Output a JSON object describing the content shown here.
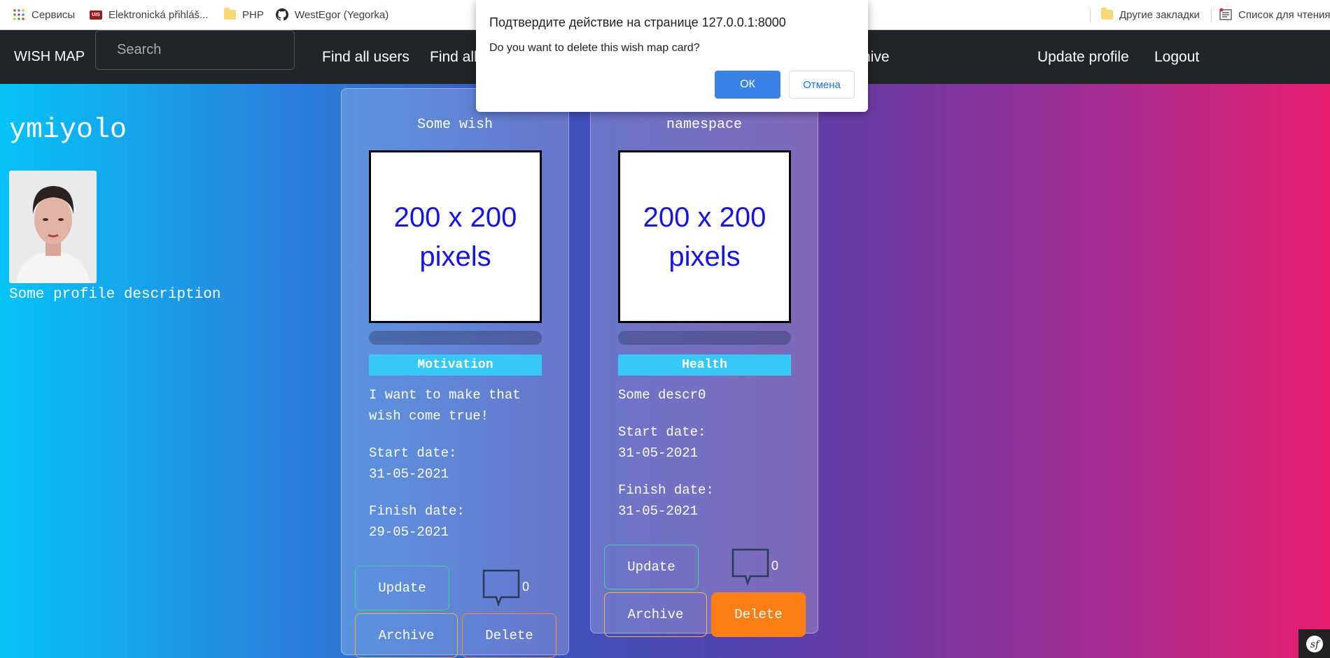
{
  "bookmarks": {
    "items": [
      {
        "label": "Сервисы"
      },
      {
        "label": "Elektronická přihláš..."
      },
      {
        "label": "PHP"
      },
      {
        "label": "WestEgor (Yegorka)"
      }
    ],
    "other_bookmarks": "Другие закладки",
    "reading_list": "Список для чтения"
  },
  "navbar": {
    "brand": "WISH MAP",
    "search_placeholder": "Search",
    "links": [
      "Find all users",
      "Find all",
      "hive"
    ],
    "right_links": [
      "Update profile",
      "Logout"
    ]
  },
  "profile": {
    "username": "ymiyolo",
    "description": "Some profile description"
  },
  "cards": [
    {
      "title": "Some wish",
      "image_text_line1": "200 x 200",
      "image_text_line2": "pixels",
      "category": "Motivation",
      "description_line1": "I want to make that",
      "description_line2": "wish come true!",
      "start_label": "Start date:",
      "start_date": "31-05-2021",
      "finish_label": "Finish date:",
      "finish_date": "29-05-2021",
      "update": "Update",
      "archive": "Archive",
      "delete": "Delete",
      "comments": "0"
    },
    {
      "title": "namespace",
      "image_text_line1": "200 x 200",
      "image_text_line2": "pixels",
      "category": "Health",
      "description": "Some descr0",
      "start_label": "Start date:",
      "start_date": "31-05-2021",
      "finish_label": "Finish date:",
      "finish_date": "31-05-2021",
      "update": "Update",
      "archive": "Archive",
      "delete": "Delete",
      "comments": "0"
    }
  ],
  "dialog": {
    "title": "Подтвердите действие на странице 127.0.0.1:8000",
    "message": "Do you want to delete this wish map card?",
    "ok": "ОК",
    "cancel": "Отмена"
  },
  "colors": {
    "navbar": "#212529",
    "category": "#37c8f5",
    "delete_active": "#fd7e14",
    "ok_button": "#3b82e8"
  }
}
